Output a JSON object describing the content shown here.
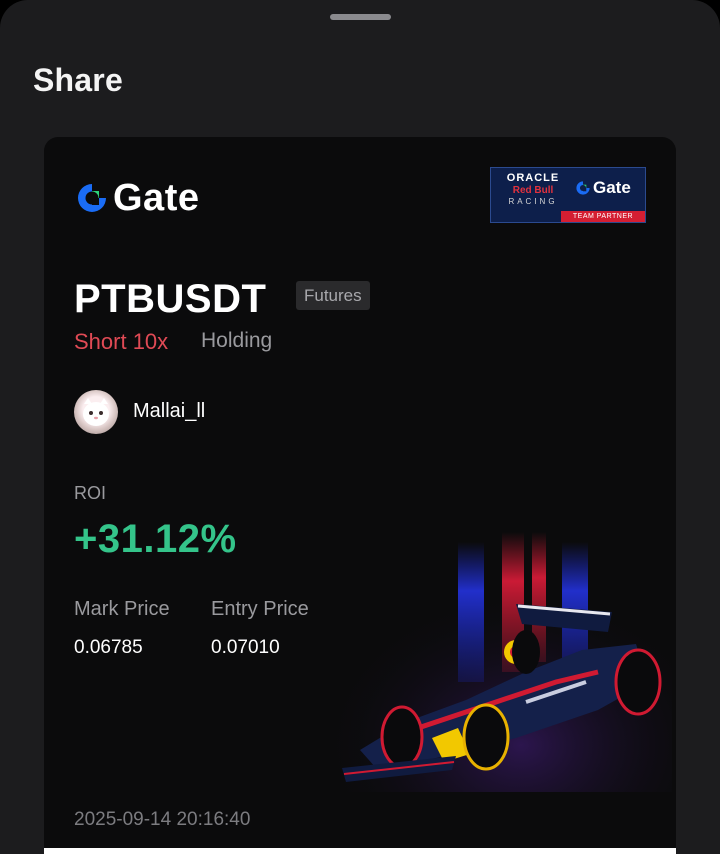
{
  "sheet": {
    "title": "Share"
  },
  "card": {
    "brand": "Gate",
    "partner": {
      "oracle": "ORACLE",
      "redbull": "Red Bull",
      "racing": "RACING",
      "gate": "Gate",
      "tag": "TEAM PARTNER"
    },
    "pair": "PTBUSDT",
    "badge": "Futures",
    "side": "Short 10x",
    "status": "Holding",
    "username": "Mallai_ll",
    "roi_label": "ROI",
    "roi_value": "+31.12%",
    "mark_price_label": "Mark Price",
    "entry_price_label": "Entry Price",
    "mark_price": "0.06785",
    "entry_price": "0.07010",
    "timestamp": "2025-09-14 20:16:40"
  },
  "colors": {
    "brand_blue": "#1a6cf5",
    "brand_green": "#2cd37c",
    "short_red": "#e04a55",
    "roi_green": "#34c48a"
  },
  "icons": [
    "gate-logo-icon",
    "avatar-image",
    "f1-car-illustration"
  ]
}
